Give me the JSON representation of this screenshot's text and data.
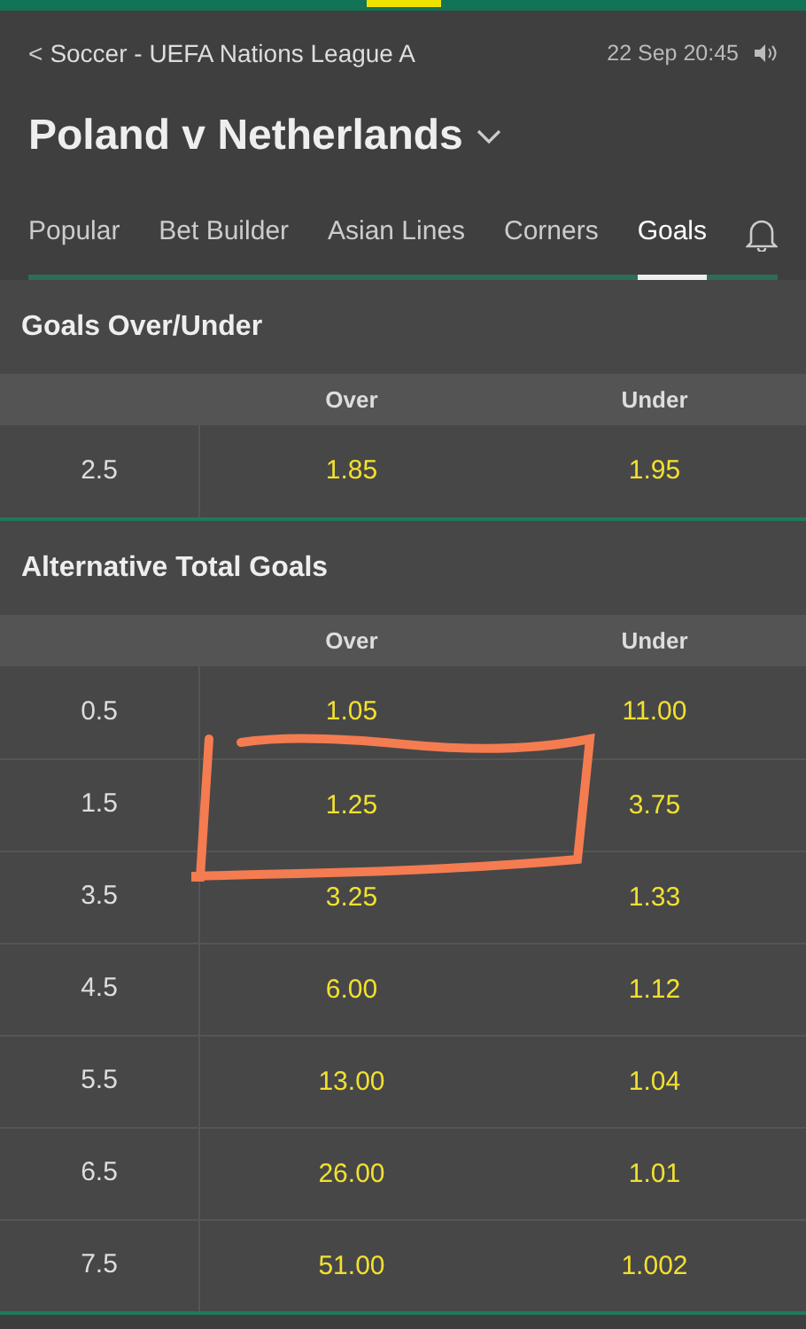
{
  "breadcrumb": {
    "back": "<",
    "label": "Soccer - UEFA Nations League A"
  },
  "datetime": "22 Sep 20:45",
  "title": "Poland v Netherlands",
  "tabs": [
    {
      "label": "Popular",
      "selected": false
    },
    {
      "label": "Bet Builder",
      "selected": false
    },
    {
      "label": "Asian Lines",
      "selected": false
    },
    {
      "label": "Corners",
      "selected": false
    },
    {
      "label": "Goals",
      "selected": true
    }
  ],
  "markets": [
    {
      "title": "Goals Over/Under",
      "columns": [
        "Over",
        "Under"
      ],
      "rows": [
        {
          "line": "2.5",
          "over": "1.85",
          "under": "1.95",
          "circled": false
        }
      ]
    },
    {
      "title": "Alternative Total Goals",
      "columns": [
        "Over",
        "Under"
      ],
      "rows": [
        {
          "line": "0.5",
          "over": "1.05",
          "under": "11.00",
          "circled": false
        },
        {
          "line": "1.5",
          "over": "1.25",
          "under": "3.75",
          "circled": true
        },
        {
          "line": "3.5",
          "over": "3.25",
          "under": "1.33",
          "circled": false
        },
        {
          "line": "4.5",
          "over": "6.00",
          "under": "1.12",
          "circled": false
        },
        {
          "line": "5.5",
          "over": "13.00",
          "under": "1.04",
          "circled": false
        },
        {
          "line": "6.5",
          "over": "26.00",
          "under": "1.01",
          "circled": false
        },
        {
          "line": "7.5",
          "over": "51.00",
          "under": "1.002",
          "circled": false
        }
      ]
    }
  ]
}
